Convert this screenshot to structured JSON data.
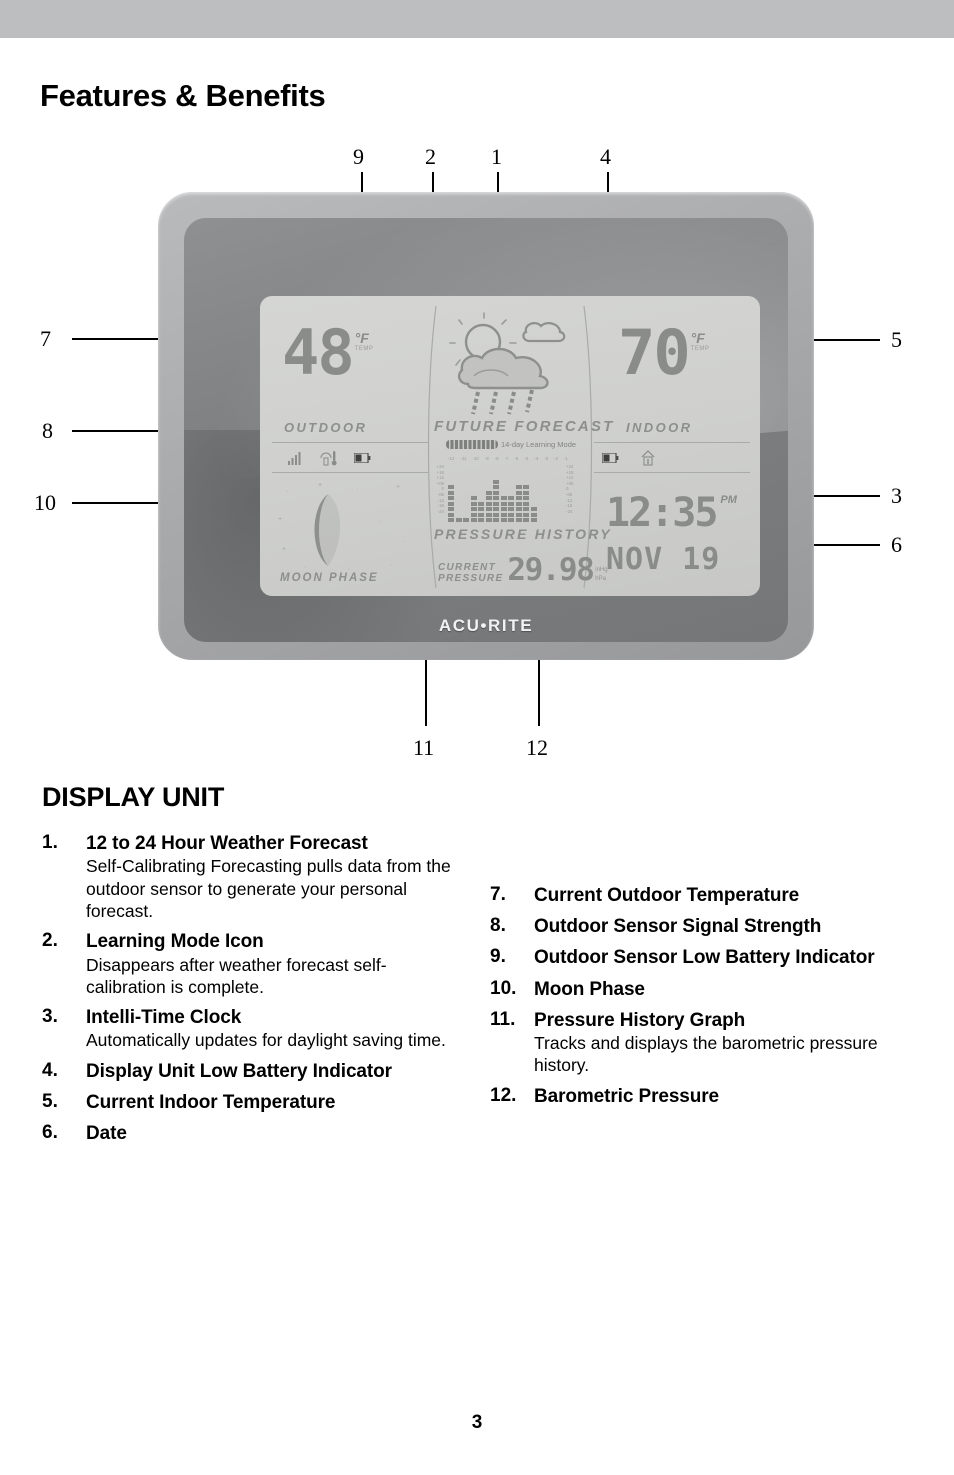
{
  "page": {
    "title": "Features & Benefits",
    "section_heading": "DISPLAY UNIT",
    "page_number": "3",
    "header_band_color": "#bcbec0"
  },
  "callouts": {
    "top": [
      "9",
      "2",
      "1",
      "4"
    ],
    "left": [
      "7",
      "8",
      "10"
    ],
    "right": [
      "5",
      "3",
      "6"
    ],
    "bottom": [
      "11",
      "12"
    ]
  },
  "device": {
    "brand": "ACU•RITE",
    "lcd": {
      "outdoor": {
        "temperature": "48",
        "unit": "°F",
        "unit_sub": "TEMP",
        "label": "OUTDOOR",
        "icons": [
          "signal-strength-icon",
          "sensor-thermometer-icon",
          "low-battery-icon"
        ]
      },
      "indoor": {
        "temperature": "70",
        "unit": "°F",
        "unit_sub": "TEMP",
        "label": "INDOOR",
        "icons": [
          "low-battery-icon",
          "indoor-sensor-icon"
        ]
      },
      "forecast": {
        "title": "FUTURE FORECAST",
        "learning_mode_text": "14-day Learning Mode",
        "icon": "sun-behind-rain-cloud-icon"
      },
      "clock": {
        "time": "12:35",
        "ampm": "PM",
        "date": "NOV 19"
      },
      "moon": {
        "label": "MOON PHASE",
        "phase_icon": "waning-crescent-moon-icon"
      },
      "pressure": {
        "graph_title": "PRESSURE HISTORY",
        "current_label_line1": "CURRENT",
        "current_label_line2": "PRESSURE",
        "value": "29.98",
        "unit_primary": "inHg",
        "unit_secondary": "hPa"
      }
    }
  },
  "chart_data": {
    "type": "bar",
    "title": "PRESSURE HISTORY",
    "xlabel": "",
    "ylabel": "",
    "categories": [
      "-12",
      "-11",
      "-10",
      "-9",
      "-8",
      "-7",
      "-6",
      "-5",
      "-4",
      "-3",
      "-2",
      "-1"
    ],
    "x_tick_labels": [
      "-12",
      "-11",
      "-10",
      "-9",
      "-8",
      "-7",
      "-6",
      "-5",
      "-4",
      "-3",
      "-2",
      "-1"
    ],
    "y_tick_labels": [
      "+24",
      "+18",
      "+12",
      "+06",
      "0",
      "-06",
      "-12",
      "-18",
      "-24",
      "+24"
    ],
    "y_axis_left": [
      "+24",
      "+18",
      "+12",
      "+06",
      "0",
      "-06",
      "-12",
      "-18",
      "-24"
    ],
    "y_axis_right": [
      "+24",
      "+18",
      "+12",
      "+06",
      "0",
      "-06",
      "-12",
      "-18",
      "-24"
    ],
    "values": [
      7,
      1,
      1,
      5,
      4,
      6,
      8,
      5,
      5,
      7,
      7,
      3
    ],
    "ylim": [
      0,
      10
    ],
    "grid": false,
    "legend": "none"
  },
  "items": {
    "left_column": [
      {
        "number": "1.",
        "title": "12 to 24 Hour Weather Forecast",
        "desc": "Self-Calibrating Forecasting pulls data from the outdoor sensor to generate your personal forecast."
      },
      {
        "number": "2.",
        "title": "Learning Mode Icon",
        "desc": "Disappears after weather forecast self-calibration is complete."
      },
      {
        "number": "3.",
        "title": "Intelli-Time Clock",
        "desc": "Automatically updates for daylight saving time."
      },
      {
        "number": "4.",
        "title": "Display Unit Low Battery Indicator",
        "desc": ""
      },
      {
        "number": "5.",
        "title": "Current Indoor Temperature",
        "desc": ""
      },
      {
        "number": "6.",
        "title": "Date",
        "desc": ""
      }
    ],
    "right_column": [
      {
        "number": "7.",
        "title": "Current Outdoor Temperature",
        "desc": ""
      },
      {
        "number": "8.",
        "title": "Outdoor Sensor Signal Strength",
        "desc": ""
      },
      {
        "number": "9.",
        "title": "Outdoor Sensor Low Battery Indicator",
        "desc": ""
      },
      {
        "number": "10.",
        "title": "Moon Phase",
        "desc": ""
      },
      {
        "number": "11.",
        "title": "Pressure History Graph",
        "desc": "Tracks and displays the barometric pressure history."
      },
      {
        "number": "12.",
        "title": "Barometric Pressure",
        "desc": ""
      }
    ]
  }
}
